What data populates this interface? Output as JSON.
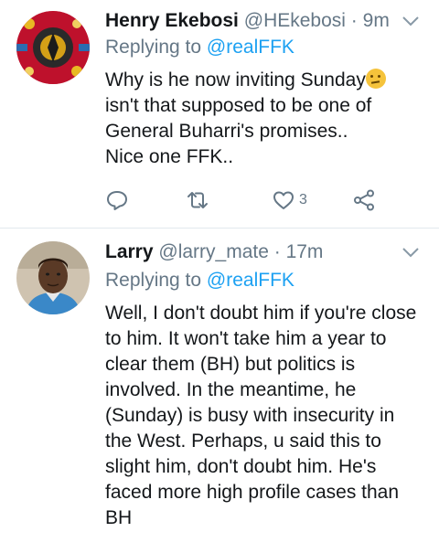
{
  "tweets": [
    {
      "name": "Henry Ekebosi",
      "handle": "@HEkebosi",
      "separator": "·",
      "time": "9m",
      "replying_prefix": "Replying to ",
      "replying_to": "@realFFK",
      "body_line1": "Why is he now inviting Sunday",
      "body_emoji": "thinking-face-emoji",
      "body_rest": "isn't that supposed to be one of\nGeneral Buharri's promises..\n   Nice one FFK..",
      "like_count": "3"
    },
    {
      "name": "Larry",
      "handle": "@larry_mate",
      "separator": "·",
      "time": "17m",
      "replying_prefix": "Replying to ",
      "replying_to": "@realFFK",
      "body": "Well, I don't doubt him if you're close to him. It won't take him a year to clear them (BH) but politics is involved. In the meantime, he (Sunday) is busy with insecurity in the West. Perhaps, u said this to slight him, don't doubt him. He's faced more high profile cases than BH"
    }
  ],
  "colors": {
    "text": "#14171a",
    "secondary": "#657786",
    "link": "#1da1f2",
    "divider": "#e1e8ed"
  },
  "icons": [
    "reply-icon",
    "retweet-icon",
    "like-icon",
    "share-icon",
    "chevron-down-icon"
  ]
}
